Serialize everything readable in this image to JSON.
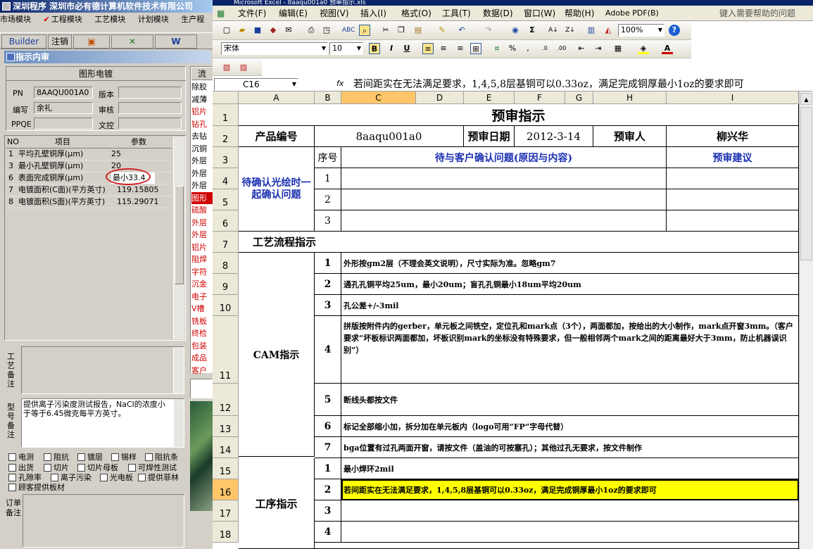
{
  "left": {
    "title": "深圳程序  深圳市必有德计算机软件技术有限公司",
    "menu": [
      "市场模块",
      "工程模块",
      "工艺模块",
      "计划模块",
      "生产程"
    ],
    "toolbar": {
      "builder": "Builder",
      "cancel": "注销"
    },
    "panel_title": "指示内审",
    "section": "图形电镀",
    "fields": {
      "pn_label": "PN",
      "pn_value": "8AAQU001A0",
      "version_label": "版本",
      "author_label": "编写",
      "author_value": "余礼",
      "review_label": "审核",
      "ppqe_label": "PPQE",
      "doc_label": "文控"
    },
    "grid": {
      "headers": [
        "NO",
        "项目",
        "参数"
      ],
      "rows": [
        [
          "1",
          "平均孔壁铜厚(μm)",
          "25"
        ],
        [
          "3",
          "最小孔壁铜厚(μm)",
          "20"
        ],
        [
          "6",
          "表面完成铜厚(μm)",
          "最小33.4"
        ],
        [
          "7",
          "电镀面积(C面)(平方英寸)",
          "119.15805"
        ],
        [
          "8",
          "电镀面积(S面)(平方英寸)",
          "115.29071"
        ]
      ]
    },
    "process_label": "工艺备注",
    "model_label": "型号备注",
    "model_note": "提供离子污染度测试报告，NaCl的浓度小于等于6.45微克每平方英寸。",
    "checks": [
      [
        "电测",
        "阻抗",
        "镀层",
        "锡样",
        "阻抗条"
      ],
      [
        "出货",
        "切片",
        "切片母板",
        "可焊性测试"
      ],
      [
        "孔隙率",
        "离子污染",
        "光电板",
        "提供菲林"
      ],
      [
        "顾客提供板材"
      ]
    ],
    "order_label": "订单备注",
    "flow_header": "流",
    "flow": [
      "除胶",
      "减薄",
      "铝片",
      "钻孔",
      "去钻",
      "沉铜",
      "外层",
      "外层",
      "外层",
      "图形",
      "硫酸",
      "外层",
      "外层",
      "铝片",
      "阻焊",
      "字符",
      "沉金",
      "电子",
      "V槽",
      "铣板",
      "终检",
      "包装",
      "成品",
      "客户"
    ]
  },
  "excel": {
    "title": "Microsoft Excel - 8aaqu001a0 预审指示.xls",
    "menu": [
      "文件(F)",
      "编辑(E)",
      "视图(V)",
      "插入(I)",
      "格式(O)",
      "工具(T)",
      "数据(D)",
      "窗口(W)",
      "帮助(H)",
      "Adobe PDF(B)"
    ],
    "help_placeholder": "键入需要帮助的问题",
    "zoom": "100%",
    "font_name": "宋体",
    "font_size": "10",
    "cell_ref": "C16",
    "fx": "fx",
    "formula": "若间距实在无法满足要求，1,4,5,8层基铜可以0.33oz，满足完成铜厚最小1oz的要求即可",
    "columns": [
      "A",
      "B",
      "C",
      "D",
      "E",
      "F",
      "G",
      "H",
      "I"
    ],
    "rows": [
      "1",
      "2",
      "3",
      "4",
      "5",
      "6",
      "7",
      "8",
      "9",
      "10",
      "11",
      "12",
      "13",
      "14",
      "15",
      "16",
      "17",
      "18"
    ],
    "cells": {
      "title": "预审指示",
      "pn_label": "产品编号",
      "pn": "8aaqu001a0",
      "date_label": "预审日期",
      "date": "2012-3-14",
      "reviewer_label": "预审人",
      "reviewer": "柳兴华",
      "confirm": "待确认光绘时一起确认问题",
      "seq": "序号",
      "question": "待与客户确认问题(原因与内容)",
      "advice": "预审建议",
      "n1": "1",
      "n2": "2",
      "n3": "3",
      "flow_title": "工艺流程指示",
      "cam": "CAM指示",
      "c1": "外形按gm2层（不理会英文说明），尺寸实际为准。忽略gm7",
      "c2": "通孔孔铜平均25um，最小20um；盲孔孔铜最小18um平均20um",
      "c3": "孔公差+/-3mil",
      "c4": "拼版按附件内的gerber，单元板之间铣空，定位孔和mark点（3个），两面都加，按给出的大小制作，mark点开窗3mm。（客户要求“坏板标识两面都加，坏板识别mark的坐标没有特殊要求，但一般相邻两个mark之间的距离最好大于3mm，防止机器误识别”）",
      "c5": "断线头都按文件",
      "c6": "标记全部缩小加，拆分加在单元板内（logo可用“FP”字母代替）",
      "c7": "bga位置有过孔两面开窗，请按文件（盖油的可按塞孔）；其他过孔无要求，按文件制作",
      "process": "工序指示",
      "p1": "最小焊环2mil",
      "p2": "若间距实在无法满足要求，1,4,5,8层基铜可以0.33oz，满足完成铜厚最小1oz的要求即可",
      "nums": [
        "1",
        "2",
        "3",
        "4",
        "5",
        "6",
        "7"
      ],
      "pnums": [
        "1",
        "2",
        "3",
        "4"
      ]
    },
    "highlight": "#ffff00"
  }
}
